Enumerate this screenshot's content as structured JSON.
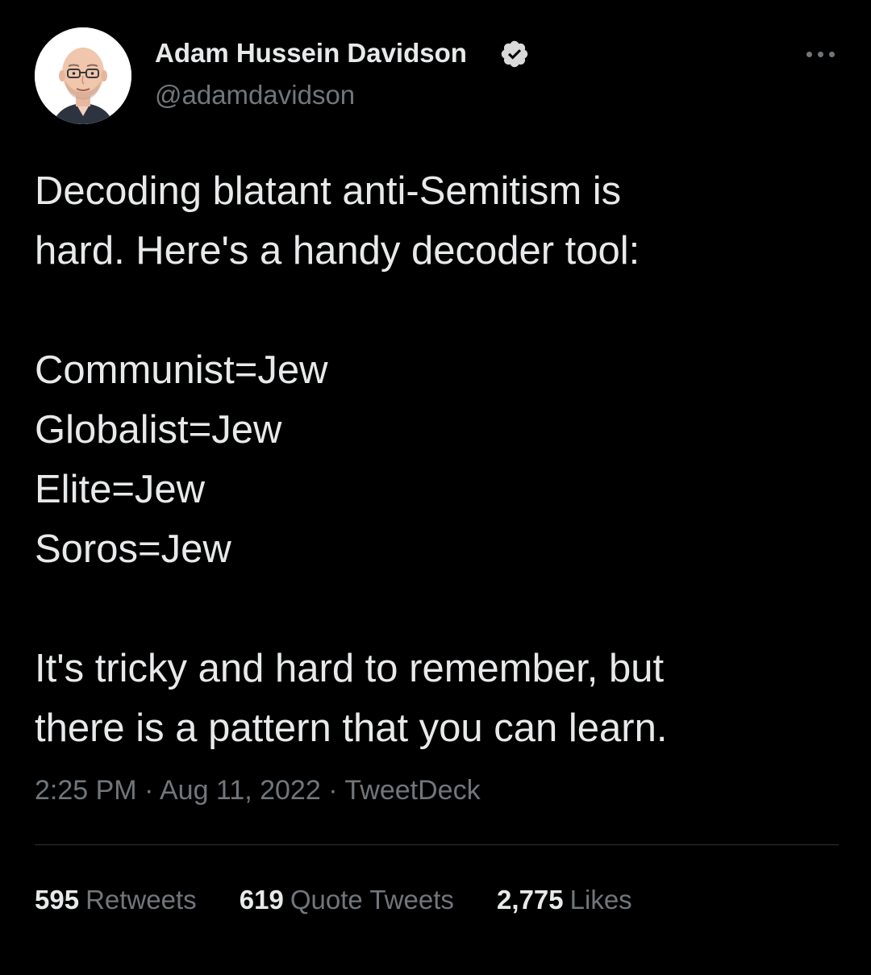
{
  "author": {
    "display_name": "Adam Hussein Davidson",
    "handle": "@adamdavidson",
    "verified": true
  },
  "tweet": {
    "text_lines": [
      "Decoding blatant anti-Semitism is",
      "hard. Here's a handy decoder tool:",
      "",
      "Communist=Jew",
      "Globalist=Jew",
      "Elite=Jew",
      "Soros=Jew",
      "",
      "It's tricky and hard to remember, but",
      "there is a pattern that you can learn."
    ],
    "time": "2:25 PM",
    "date": "Aug 11, 2022",
    "source": "TweetDeck",
    "separator": "·"
  },
  "stats": {
    "retweets": {
      "count": "595",
      "label": "Retweets"
    },
    "quote_tweets": {
      "count": "619",
      "label": "Quote Tweets"
    },
    "likes": {
      "count": "2,775",
      "label": "Likes"
    }
  },
  "colors": {
    "background": "#000000",
    "primary_text": "#e7e9ea",
    "secondary_text": "#71767b",
    "verified_badge": "#d9d9d9",
    "divider": "#2f3336"
  },
  "icons": {
    "verified": "verified-badge-icon",
    "more": "more-horizontal-icon"
  }
}
